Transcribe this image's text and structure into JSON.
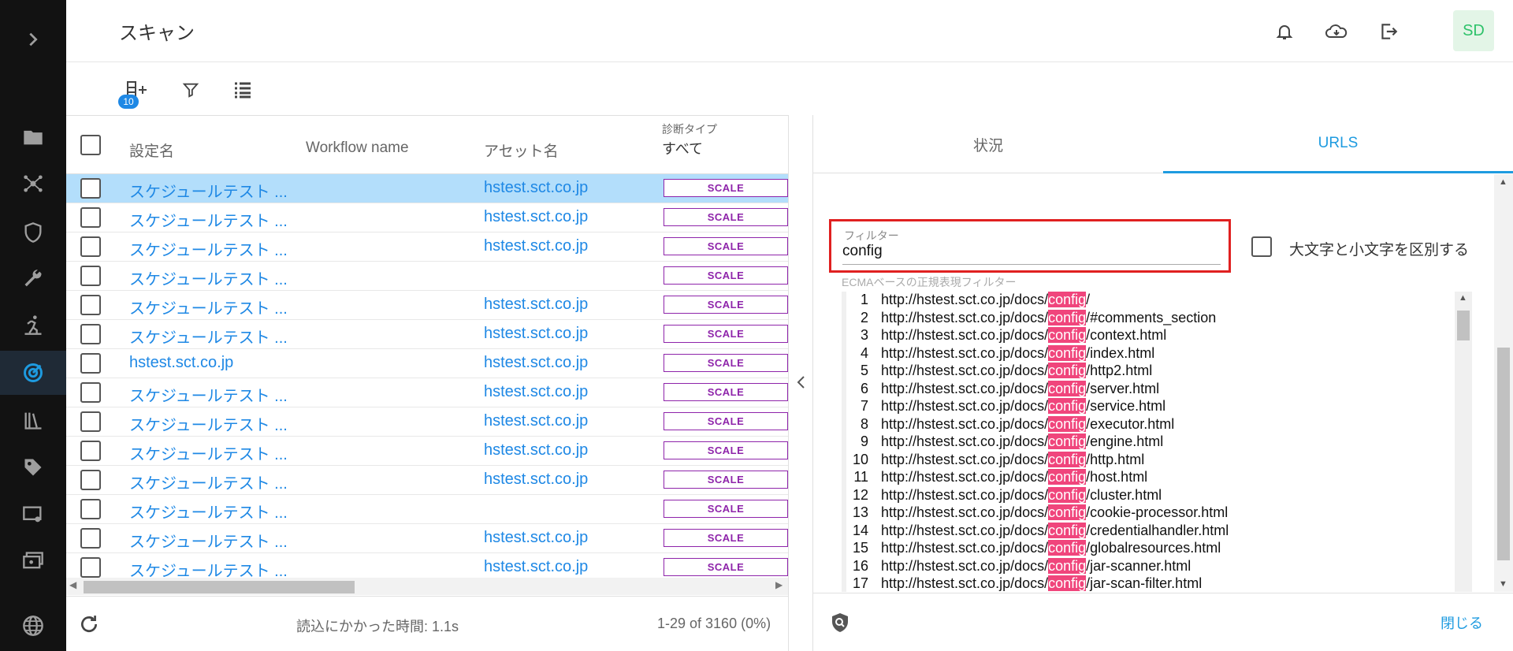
{
  "header": {
    "title": "スキャン",
    "avatar_initials": "SD"
  },
  "toolbar": {
    "badge_count": "10"
  },
  "table": {
    "columns": {
      "name": "設定名",
      "workflow": "Workflow name",
      "asset": "アセット名",
      "diag_type_label": "診断タイプ",
      "diag_type_value": "すべて"
    },
    "rows": [
      {
        "name": "スケジュールテスト ...",
        "asset": "hstest.sct.co.jp",
        "type": "SCALE"
      },
      {
        "name": "スケジュールテスト ...",
        "asset": "hstest.sct.co.jp",
        "type": "SCALE"
      },
      {
        "name": "スケジュールテスト ...",
        "asset": "hstest.sct.co.jp",
        "type": "SCALE"
      },
      {
        "name": "スケジュールテスト ...",
        "asset": "",
        "type": "SCALE"
      },
      {
        "name": "スケジュールテスト ...",
        "asset": "hstest.sct.co.jp",
        "type": "SCALE"
      },
      {
        "name": "スケジュールテスト ...",
        "asset": "hstest.sct.co.jp",
        "type": "SCALE"
      },
      {
        "name": "hstest.sct.co.jp",
        "asset": "hstest.sct.co.jp",
        "type": "SCALE"
      },
      {
        "name": "スケジュールテスト ...",
        "asset": "hstest.sct.co.jp",
        "type": "SCALE"
      },
      {
        "name": "スケジュールテスト ...",
        "asset": "hstest.sct.co.jp",
        "type": "SCALE"
      },
      {
        "name": "スケジュールテスト ...",
        "asset": "hstest.sct.co.jp",
        "type": "SCALE"
      },
      {
        "name": "スケジュールテスト ...",
        "asset": "hstest.sct.co.jp",
        "type": "SCALE"
      },
      {
        "name": "スケジュールテスト ...",
        "asset": "",
        "type": "SCALE"
      },
      {
        "name": "スケジュールテスト ...",
        "asset": "hstest.sct.co.jp",
        "type": "SCALE"
      },
      {
        "name": "スケジュールテスト ...",
        "asset": "hstest.sct.co.jp",
        "type": "SCALE"
      }
    ]
  },
  "status": {
    "load_time": "読込にかかった時間: 1.1s",
    "pagination": "1-29 of 3160 (0%)"
  },
  "tabs": {
    "status": "状況",
    "urls": "URLS"
  },
  "filter": {
    "label": "フィルター",
    "value": "config",
    "hint": "ECMAベースの正規表現フィルター",
    "case_label": "大文字と小文字を区別する"
  },
  "urls": [
    {
      "num": "1",
      "prefix": "http://hstest.sct.co.jp/docs/",
      "match": "config",
      "suffix": "/"
    },
    {
      "num": "2",
      "prefix": "http://hstest.sct.co.jp/docs/",
      "match": "config",
      "suffix": "/#comments_section"
    },
    {
      "num": "3",
      "prefix": "http://hstest.sct.co.jp/docs/",
      "match": "config",
      "suffix": "/context.html"
    },
    {
      "num": "4",
      "prefix": "http://hstest.sct.co.jp/docs/",
      "match": "config",
      "suffix": "/index.html"
    },
    {
      "num": "5",
      "prefix": "http://hstest.sct.co.jp/docs/",
      "match": "config",
      "suffix": "/http2.html"
    },
    {
      "num": "6",
      "prefix": "http://hstest.sct.co.jp/docs/",
      "match": "config",
      "suffix": "/server.html"
    },
    {
      "num": "7",
      "prefix": "http://hstest.sct.co.jp/docs/",
      "match": "config",
      "suffix": "/service.html"
    },
    {
      "num": "8",
      "prefix": "http://hstest.sct.co.jp/docs/",
      "match": "config",
      "suffix": "/executor.html"
    },
    {
      "num": "9",
      "prefix": "http://hstest.sct.co.jp/docs/",
      "match": "config",
      "suffix": "/engine.html"
    },
    {
      "num": "10",
      "prefix": "http://hstest.sct.co.jp/docs/",
      "match": "config",
      "suffix": "/http.html"
    },
    {
      "num": "11",
      "prefix": "http://hstest.sct.co.jp/docs/",
      "match": "config",
      "suffix": "/host.html"
    },
    {
      "num": "12",
      "prefix": "http://hstest.sct.co.jp/docs/",
      "match": "config",
      "suffix": "/cluster.html"
    },
    {
      "num": "13",
      "prefix": "http://hstest.sct.co.jp/docs/",
      "match": "config",
      "suffix": "/cookie-processor.html"
    },
    {
      "num": "14",
      "prefix": "http://hstest.sct.co.jp/docs/",
      "match": "config",
      "suffix": "/credentialhandler.html"
    },
    {
      "num": "15",
      "prefix": "http://hstest.sct.co.jp/docs/",
      "match": "config",
      "suffix": "/globalresources.html"
    },
    {
      "num": "16",
      "prefix": "http://hstest.sct.co.jp/docs/",
      "match": "config",
      "suffix": "/jar-scanner.html"
    },
    {
      "num": "17",
      "prefix": "http://hstest.sct.co.jp/docs/",
      "match": "config",
      "suffix": "/jar-scan-filter.html"
    }
  ],
  "footer": {
    "close_label": "閉じる"
  },
  "colors": {
    "accent": "#1e9be0",
    "link": "#1e88e5",
    "badge_purple": "#8e24aa",
    "highlight": "#f0457c",
    "selected_row": "#b3defb"
  }
}
